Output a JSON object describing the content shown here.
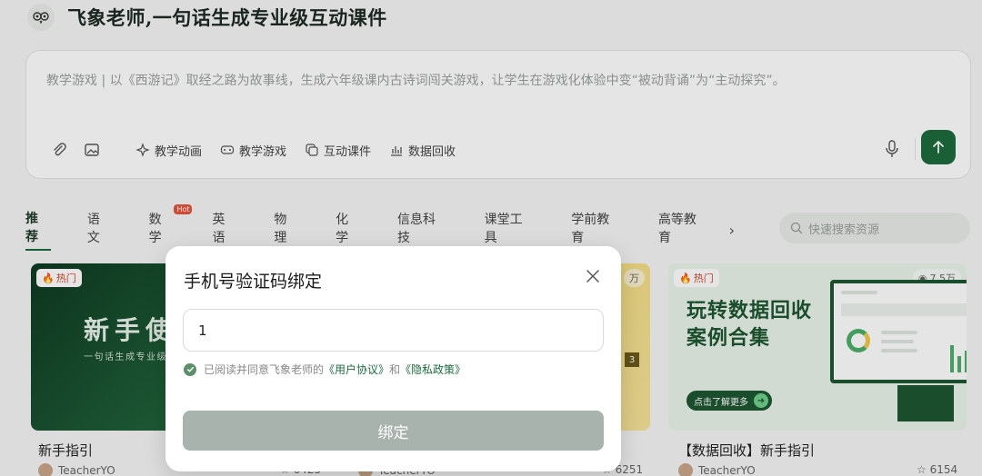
{
  "header": {
    "title": "飞象老师,一句话生成专业级互动课件",
    "logo_icon": "owl-logo-icon"
  },
  "composer": {
    "placeholder": "教学游戏 | 以《西游记》取经之路为故事线，生成六年级课内古诗词闯关游戏，让学生在游戏化体验中变“被动背诵”为“主动探究”。",
    "tools": [
      "教学动画",
      "教学游戏",
      "互动课件",
      "数据回收"
    ]
  },
  "categories": {
    "items": [
      "推荐",
      "语文",
      "数学",
      "英语",
      "物理",
      "化学",
      "信息科技",
      "课堂工具",
      "学前教育",
      "高等教育"
    ],
    "hot_badge": "Hot",
    "search_placeholder": "快速搜索资源"
  },
  "cards": [
    {
      "badge": "热门",
      "headline": "新手使",
      "subline": "一句话生成专业级",
      "name": "新手指引",
      "author": "TeacherYO",
      "stars": "6425"
    },
    {
      "badge": "",
      "views": "万",
      "number": "3",
      "name": "",
      "author": "TeacherYO",
      "stars": "6251"
    },
    {
      "badge": "热门",
      "views": "7.5万",
      "headline": "玩转数据回收案例合集",
      "cta": "点击了解更多",
      "name": "【数据回收】新手指引",
      "author": "TeacherYO",
      "stars": "6154"
    }
  ],
  "modal": {
    "title": "手机号验证码绑定",
    "code_value": "1",
    "agree_prefix": "已阅读并同意飞象老师的",
    "user_agreement": "《用户协议》",
    "and": "和",
    "privacy_policy": "《隐私政策》",
    "submit_label": "绑定"
  },
  "colors": {
    "brand": "#1d6b3e",
    "disabled_button": "#a9b3ad",
    "hot": "#e5533d"
  }
}
